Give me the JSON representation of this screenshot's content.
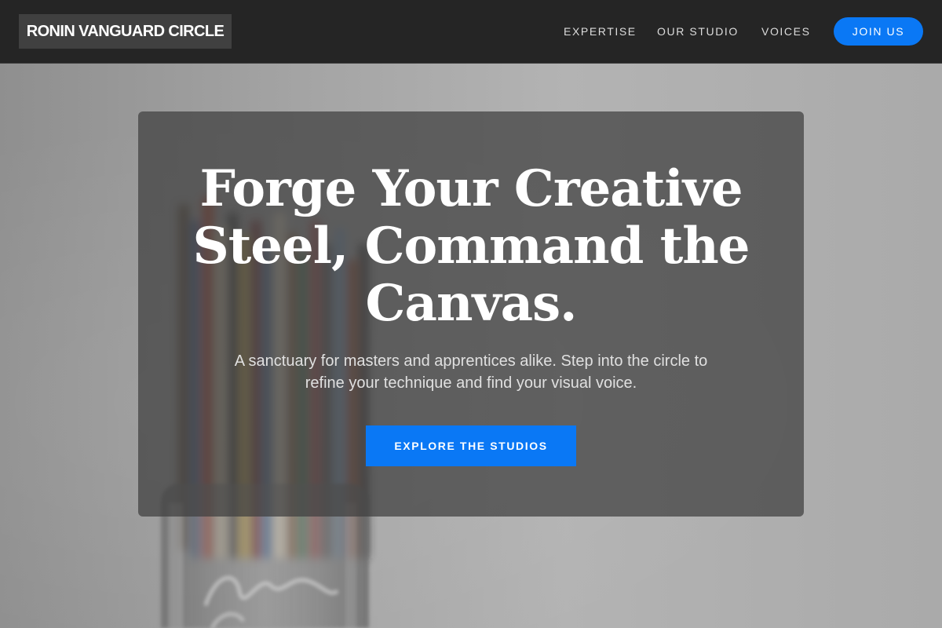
{
  "header": {
    "brand": "RONIN VANGUARD CIRCLE",
    "nav": {
      "expertise": "EXPERTISE",
      "studio": "OUR STUDIO",
      "voices": "VOICES"
    },
    "join_label": "JOIN US"
  },
  "hero": {
    "title": "Forge Your Creative Steel, Command the Canvas.",
    "subtitle": "A sanctuary for masters and apprentices alike. Step into the circle to refine your technique and find your visual voice.",
    "cta_label": "EXPLORE THE STUDIOS"
  },
  "colors": {
    "header_bg": "#252525",
    "accent": "#0a78f5",
    "card_overlay": "rgba(62,62,62,0.72)"
  }
}
